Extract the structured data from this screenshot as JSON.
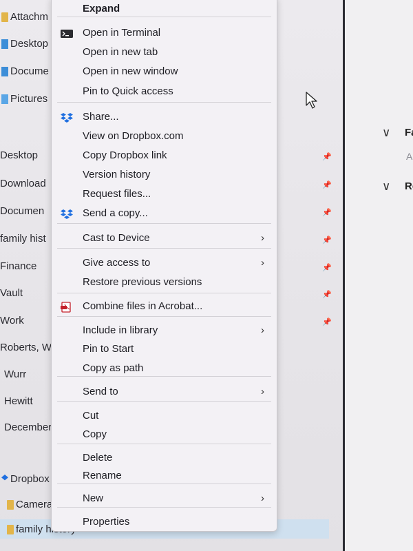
{
  "nav": {
    "top_items": [
      {
        "label": "Attachm",
        "icon": "folder-icon"
      },
      {
        "label": "Desktop",
        "icon": "desktop-icon"
      },
      {
        "label": "Docume",
        "icon": "documents-icon"
      },
      {
        "label": "Pictures",
        "icon": "pictures-icon"
      }
    ],
    "quick_access": [
      {
        "label": "Desktop"
      },
      {
        "label": "Download"
      },
      {
        "label": "Documen"
      },
      {
        "label": "family hist"
      },
      {
        "label": "Finance"
      },
      {
        "label": "Vault"
      },
      {
        "label": "Work"
      },
      {
        "label": "Roberts, W"
      },
      {
        "label": "Wurr"
      },
      {
        "label": "Hewitt"
      },
      {
        "label": "December"
      }
    ],
    "dropbox": {
      "label": "Dropbox"
    },
    "dropbox_children": [
      {
        "label": "Camera"
      },
      {
        "label": "family history"
      }
    ],
    "pin_glyph": "📌"
  },
  "right_pane": {
    "sections": [
      {
        "chevron": "∨",
        "label": "Fa"
      },
      {
        "chevron": "∨",
        "label": "Re"
      }
    ],
    "subtext": "A"
  },
  "context_menu": {
    "groups": [
      [
        {
          "label": "Expand",
          "bold": true
        }
      ],
      [
        {
          "label": "Open in Terminal",
          "icon": "terminal-icon"
        },
        {
          "label": "Open in new tab"
        },
        {
          "label": "Open in new window"
        },
        {
          "label": "Pin to Quick access"
        }
      ],
      [
        {
          "label": "Share...",
          "icon": "dropbox-icon"
        },
        {
          "label": "View on Dropbox.com"
        },
        {
          "label": "Copy Dropbox link"
        },
        {
          "label": "Version history"
        },
        {
          "label": "Request files..."
        },
        {
          "label": "Send a copy...",
          "icon": "dropbox-icon"
        }
      ],
      [
        {
          "label": "Cast to Device",
          "submenu": true
        }
      ],
      [
        {
          "label": "Give access to",
          "submenu": true
        },
        {
          "label": "Restore previous versions"
        }
      ],
      [
        {
          "label": "Combine files in Acrobat...",
          "icon": "acrobat-icon"
        }
      ],
      [
        {
          "label": "Include in library",
          "submenu": true
        },
        {
          "label": "Pin to Start"
        },
        {
          "label": "Copy as path"
        }
      ],
      [
        {
          "label": "Send to",
          "submenu": true
        }
      ],
      [
        {
          "label": "Cut"
        },
        {
          "label": "Copy"
        }
      ],
      [
        {
          "label": "Delete"
        },
        {
          "label": "Rename"
        }
      ],
      [
        {
          "label": "New",
          "submenu": true
        }
      ],
      [
        {
          "label": "Properties"
        }
      ]
    ],
    "submenu_glyph": "›"
  },
  "colors": {
    "menu_bg": "#f3f1f5",
    "selection": "#cfe0ef",
    "dropbox_blue": "#1f6fe0",
    "acrobat_red": "#c4202a"
  }
}
